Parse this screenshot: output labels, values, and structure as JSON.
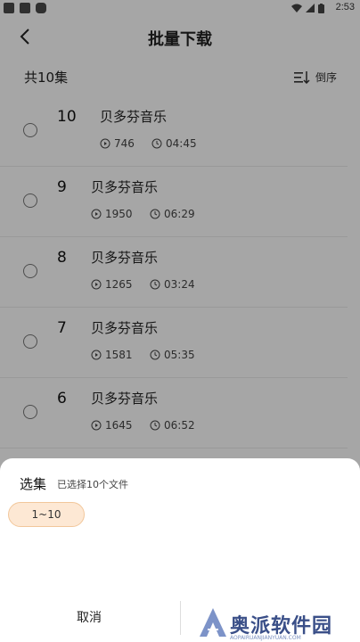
{
  "status": {
    "time": "2:53"
  },
  "header": {
    "title": "批量下载",
    "back_icon": "back-arrow-icon"
  },
  "list_header": {
    "count": "共10集",
    "sort_label": "倒序",
    "sort_icon": "sort-order-icon"
  },
  "items": [
    {
      "number": "10",
      "name": "贝多芬音乐",
      "plays": "746",
      "duration": "04:45"
    },
    {
      "number": "9",
      "name": "贝多芬音乐",
      "plays": "1950",
      "duration": "06:29"
    },
    {
      "number": "8",
      "name": "贝多芬音乐",
      "plays": "1265",
      "duration": "03:24"
    },
    {
      "number": "7",
      "name": "贝多芬音乐",
      "plays": "1581",
      "duration": "05:35"
    },
    {
      "number": "6",
      "name": "贝多芬音乐",
      "plays": "1645",
      "duration": "06:52"
    }
  ],
  "sheet": {
    "title": "选集",
    "selected_info": "已选择10个文件",
    "range": "1~10",
    "cancel_label": "取消"
  },
  "watermark": {
    "text": "奥派软件园",
    "sub": "AOPAIRUANJIANYUAN.COM",
    "color": "#3a4f88"
  }
}
